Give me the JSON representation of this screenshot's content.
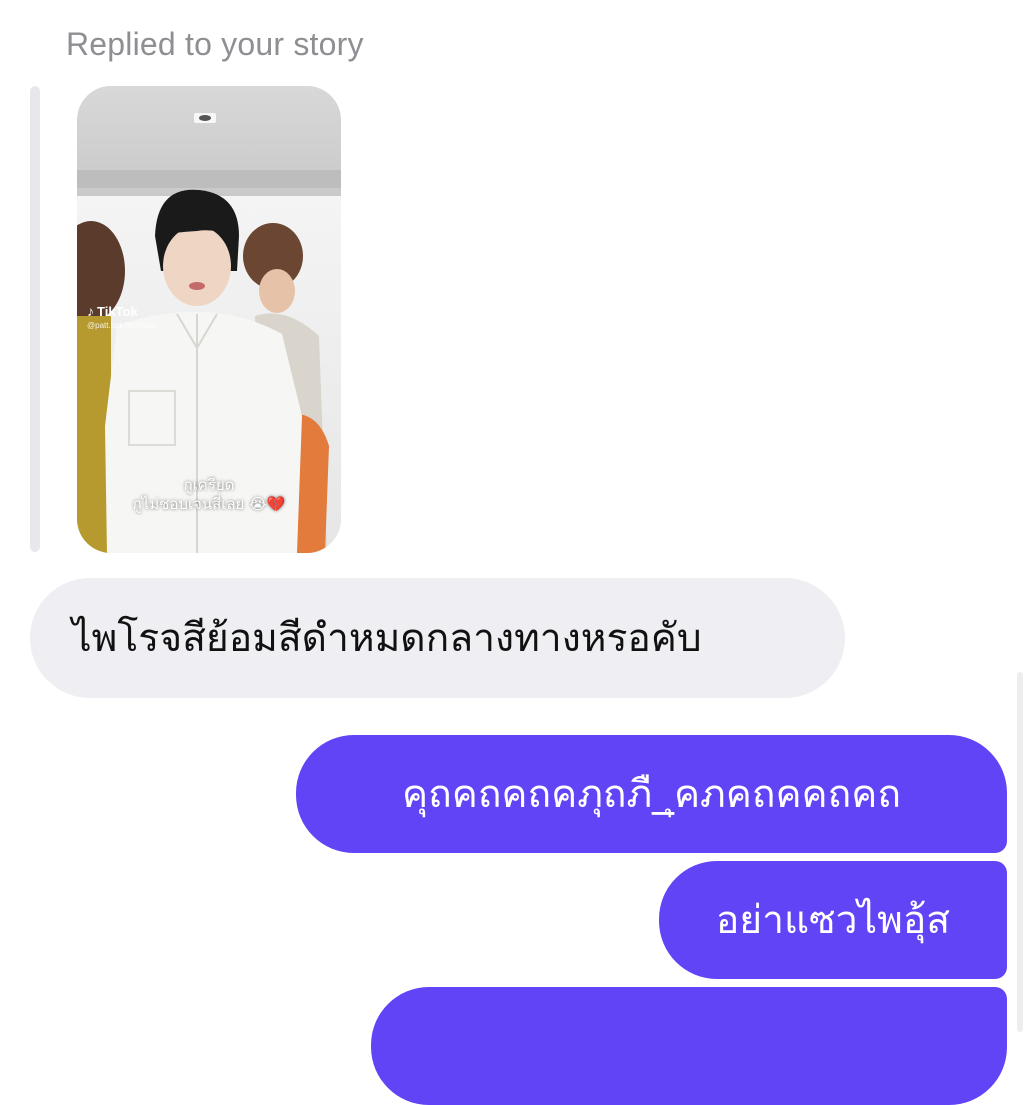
{
  "reply_context": {
    "header": "Replied to your story",
    "story": {
      "watermark_app": "TikTok",
      "watermark_handle": "@patt.bnk48official",
      "caption_line1": "กูเครียด",
      "caption_line2": "กูไม่ชอบเจนสี่เลย 😭💔"
    }
  },
  "messages": [
    {
      "sender": "them",
      "text": "ไพโรจสีย้อมสีดำหมดกลางทางหรอคับ"
    },
    {
      "sender": "me",
      "text": "คุถคถคถคภุถภื_ุคภคถคคถคถ"
    },
    {
      "sender": "me",
      "text": "อย่าแซวไพอุ้ส"
    },
    {
      "sender": "me",
      "text": ""
    }
  ],
  "colors": {
    "outgoing_bubble": "#6144f6",
    "incoming_bubble": "#efeff3",
    "header_text": "#8e8e93"
  }
}
